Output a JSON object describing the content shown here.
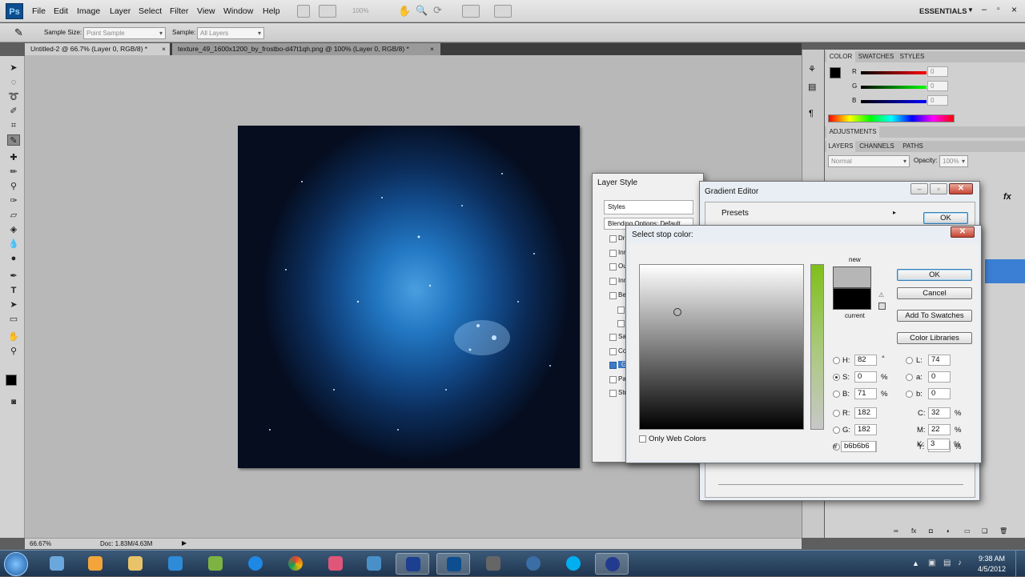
{
  "app": {
    "logo": "Ps",
    "workspace": "ESSENTIALS"
  },
  "menu": [
    "File",
    "Edit",
    "Image",
    "Layer",
    "Select",
    "Filter",
    "View",
    "Window",
    "Help"
  ],
  "toolbar": {
    "zoom_value": "100%"
  },
  "options_bar": {
    "sample_size_label": "Sample Size:",
    "sample_size_value": "Point Sample",
    "sample_label": "Sample:",
    "sample_value": "All Layers"
  },
  "doc_tabs": [
    {
      "label": "Untitled-2 @ 66.7% (Layer 0, RGB/8) *",
      "close": "×",
      "active": true
    },
    {
      "label": "texture_49_1600x1200_by_frostbo-d47t1qh.png @ 100% (Layer 0, RGB/8) *",
      "close": "×",
      "active": false
    }
  ],
  "panels": {
    "color_tabs": [
      "COLOR",
      "SWATCHES",
      "STYLES"
    ],
    "rgb_labels": [
      "R",
      "G",
      "B"
    ],
    "rgb_values": [
      "0",
      "0",
      "0"
    ],
    "adjustments": "ADJUSTMENTS",
    "layers_tabs": [
      "LAYERS",
      "CHANNELS",
      "PATHS"
    ],
    "blend_mode": "Normal",
    "opacity_label": "Opacity:",
    "opacity_value": "100%",
    "fx_label": "fx"
  },
  "layer_style": {
    "title": "Layer Style",
    "styles_label": "Styles",
    "blending": "Blending Options: Default",
    "items": [
      "Dr",
      "Inn",
      "Ou",
      "Inn",
      "Be",
      "",
      "",
      "Sat",
      "Co",
      "Gr",
      "Pat",
      "Str"
    ]
  },
  "gradient_editor": {
    "title": "Gradient Editor",
    "presets": "Presets",
    "ok": "OK"
  },
  "color_picker": {
    "title": "Select stop color:",
    "new_label": "new",
    "current_label": "current",
    "ok": "OK",
    "cancel": "Cancel",
    "add_swatches": "Add To Swatches",
    "color_libraries": "Color Libraries",
    "only_web": "Only Web Colors",
    "hsb": [
      {
        "label": "H:",
        "value": "82",
        "unit": "°"
      },
      {
        "label": "S:",
        "value": "0",
        "unit": "%"
      },
      {
        "label": "B:",
        "value": "71",
        "unit": "%"
      }
    ],
    "rgb": [
      {
        "label": "R:",
        "value": "182"
      },
      {
        "label": "G:",
        "value": "182"
      },
      {
        "label": "B:",
        "value": "182"
      }
    ],
    "lab": [
      {
        "label": "L:",
        "value": "74"
      },
      {
        "label": "a:",
        "value": "0"
      },
      {
        "label": "b:",
        "value": "0"
      }
    ],
    "cmyk": [
      {
        "label": "C:",
        "value": "32",
        "unit": "%"
      },
      {
        "label": "M:",
        "value": "22",
        "unit": "%"
      },
      {
        "label": "Y:",
        "value": "22",
        "unit": "%"
      },
      {
        "label": "K:",
        "value": "3",
        "unit": "%"
      }
    ],
    "hex_label": "#",
    "hex": "b6b6b6",
    "new_color": "#b6b6b6",
    "current_color": "#000000",
    "hue_color": "#7fbf1a"
  },
  "status": {
    "zoom": "66.67%",
    "doc": "Doc: 1.83M/4.63M"
  },
  "taskbar": {
    "time": "9:38 AM",
    "date": "4/5/2012"
  }
}
